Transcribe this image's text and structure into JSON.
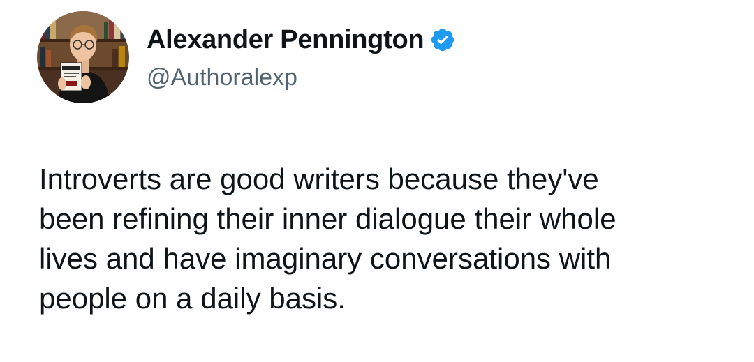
{
  "author": {
    "display_name": "Alexander Pennington",
    "handle": "@Authoralexp",
    "verified": true,
    "badge_color": "#1d9bf0"
  },
  "tweet": {
    "lines": [
      "Introverts are good writers because they've",
      "been refining their inner dialogue their whole",
      "lives and have imaginary conversations with",
      "people on a daily basis."
    ]
  },
  "colors": {
    "background": "#ffffff",
    "text_primary": "#0f1419",
    "text_secondary": "#536471"
  }
}
